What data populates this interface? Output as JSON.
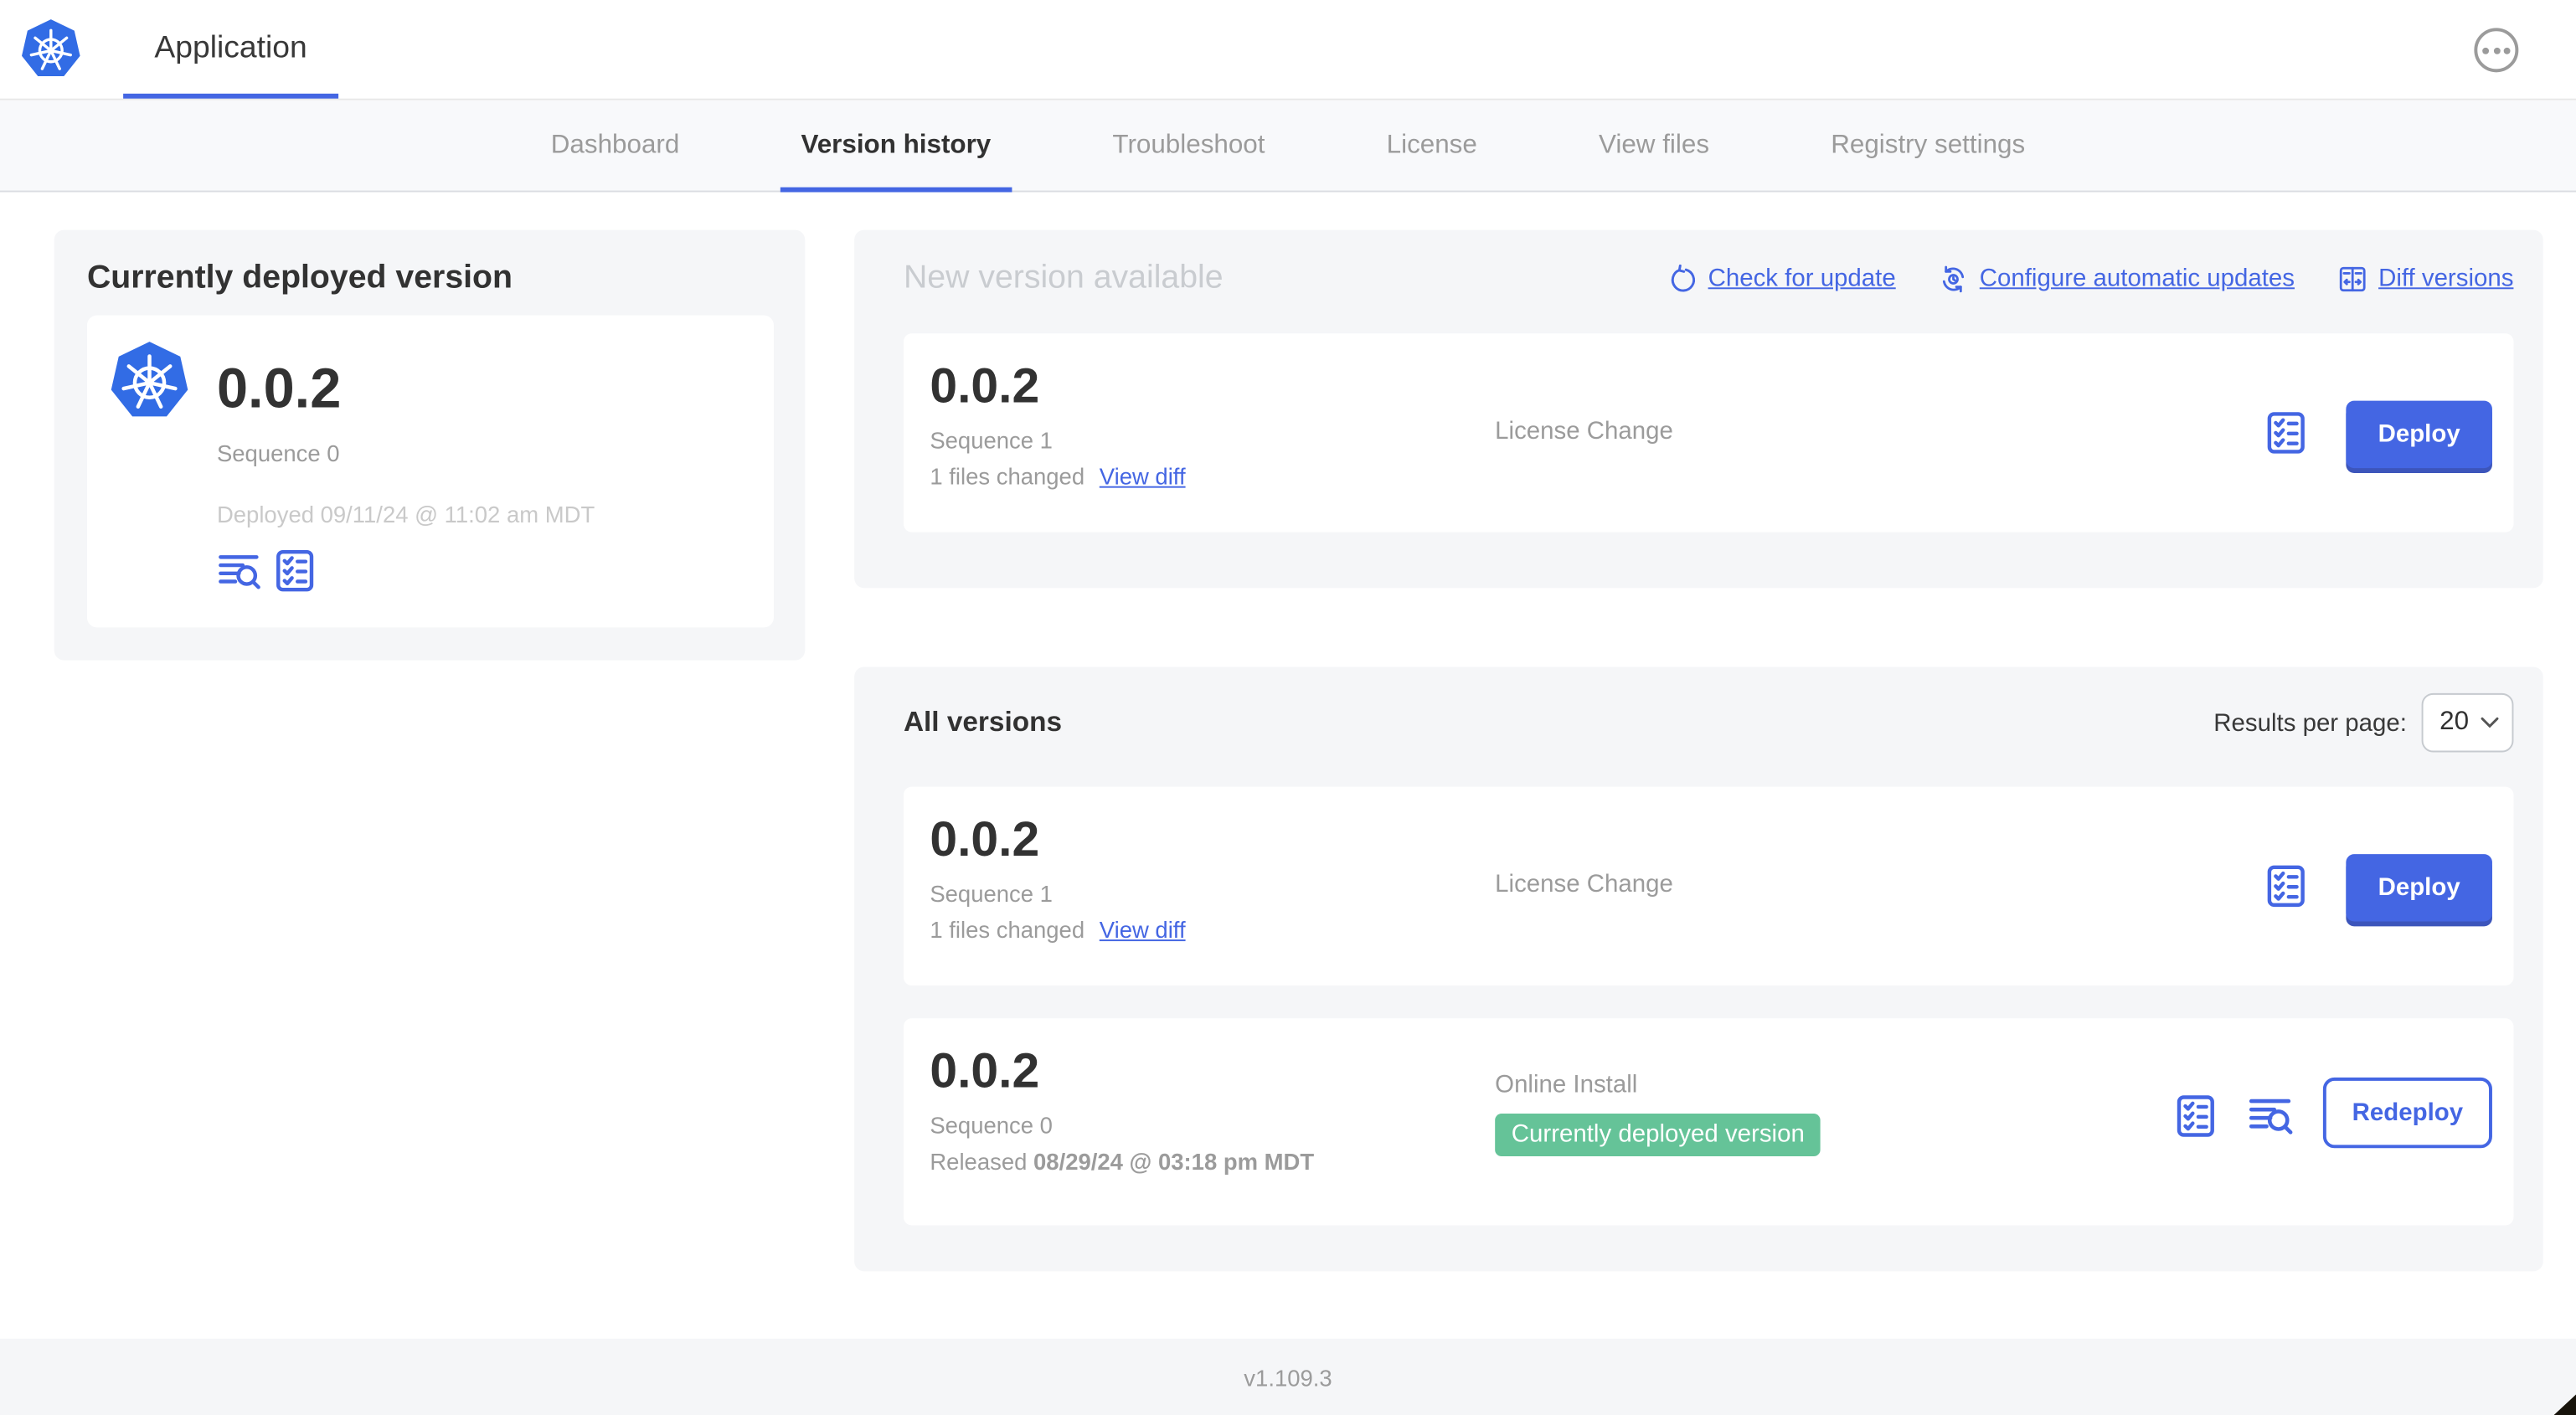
{
  "header": {
    "app_label": "Application"
  },
  "nav": {
    "tabs": [
      "Dashboard",
      "Version history",
      "Troubleshoot",
      "License",
      "View files",
      "Registry settings"
    ],
    "active_tab": "Version history"
  },
  "current": {
    "title": "Currently deployed version",
    "version": "0.0.2",
    "sequence": "Sequence 0",
    "deployed": "Deployed 09/11/24 @ 11:02 am MDT"
  },
  "new_version": {
    "title": "New version available",
    "actions": [
      {
        "label": "Check for update",
        "icon": "refresh-icon"
      },
      {
        "label": "Configure automatic updates",
        "icon": "auto-update-icon"
      },
      {
        "label": "Diff versions",
        "icon": "diff-icon"
      }
    ],
    "card": {
      "version": "0.0.2",
      "sequence": "Sequence 1",
      "files_changed": "1 files changed",
      "view_diff": "View diff",
      "source": "License Change",
      "deploy_label": "Deploy"
    }
  },
  "all_versions": {
    "title": "All versions",
    "results_per_page_label": "Results per page:",
    "results_per_page_value": "20",
    "rows": [
      {
        "version": "0.0.2",
        "sequence": "Sequence 1",
        "files_changed": "1 files changed",
        "view_diff": "View diff",
        "source": "License Change",
        "action_label": "Deploy"
      },
      {
        "version": "0.0.2",
        "sequence": "Sequence 0",
        "released_prefix": "Released ",
        "released_date": "08/29/24 @ 03:18 pm MDT",
        "source": "Online Install",
        "badge": "Currently deployed version",
        "action_label": "Redeploy"
      }
    ]
  },
  "footer": {
    "app_version": "v1.109.3"
  },
  "colors": {
    "accent_blue": "#4466e3",
    "kubernetes_blue": "#326ce5",
    "badge_green": "#65c398",
    "panel_gray": "#f5f6f8",
    "text_dark": "#323232",
    "text_gray": "#9b9b9b",
    "text_light_gray": "#c9c9c9"
  }
}
